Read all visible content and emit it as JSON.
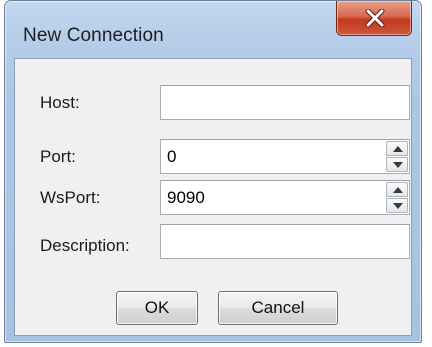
{
  "dialog": {
    "title": "New Connection",
    "close_icon": "close-x-icon"
  },
  "form": {
    "host": {
      "label": "Host:",
      "value": ""
    },
    "port": {
      "label": "Port:",
      "value": "0"
    },
    "wsport": {
      "label": "WsPort:",
      "value": "9090"
    },
    "description": {
      "label": "Description:",
      "value": ""
    }
  },
  "buttons": {
    "ok_label": "OK",
    "cancel_label": "Cancel"
  },
  "colors": {
    "frame": "#abc6e6",
    "close_button": "#c3391e",
    "client_background": "#f0f0f0"
  }
}
